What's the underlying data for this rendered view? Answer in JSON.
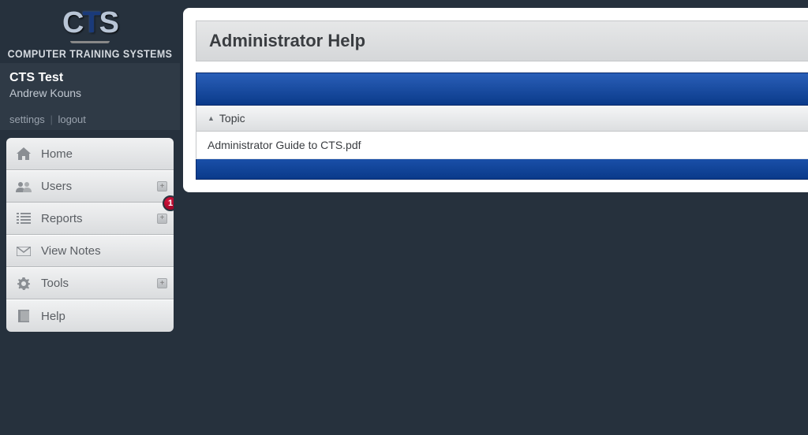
{
  "brand": {
    "logo_c": "C",
    "logo_t": "T",
    "logo_s": "S",
    "subtitle": "COMPUTER TRAINING SYSTEMS"
  },
  "user": {
    "org": "CTS Test",
    "name": "Andrew Kouns",
    "settings_label": "settings",
    "logout_label": "logout"
  },
  "nav": {
    "home": "Home",
    "users": "Users",
    "reports": "Reports",
    "view_notes": "View Notes",
    "tools": "Tools",
    "help": "Help",
    "badge_count": "1"
  },
  "main": {
    "title": "Administrator Help",
    "column_header": "Topic",
    "rows": [
      "Administrator Guide to CTS.pdf"
    ]
  }
}
